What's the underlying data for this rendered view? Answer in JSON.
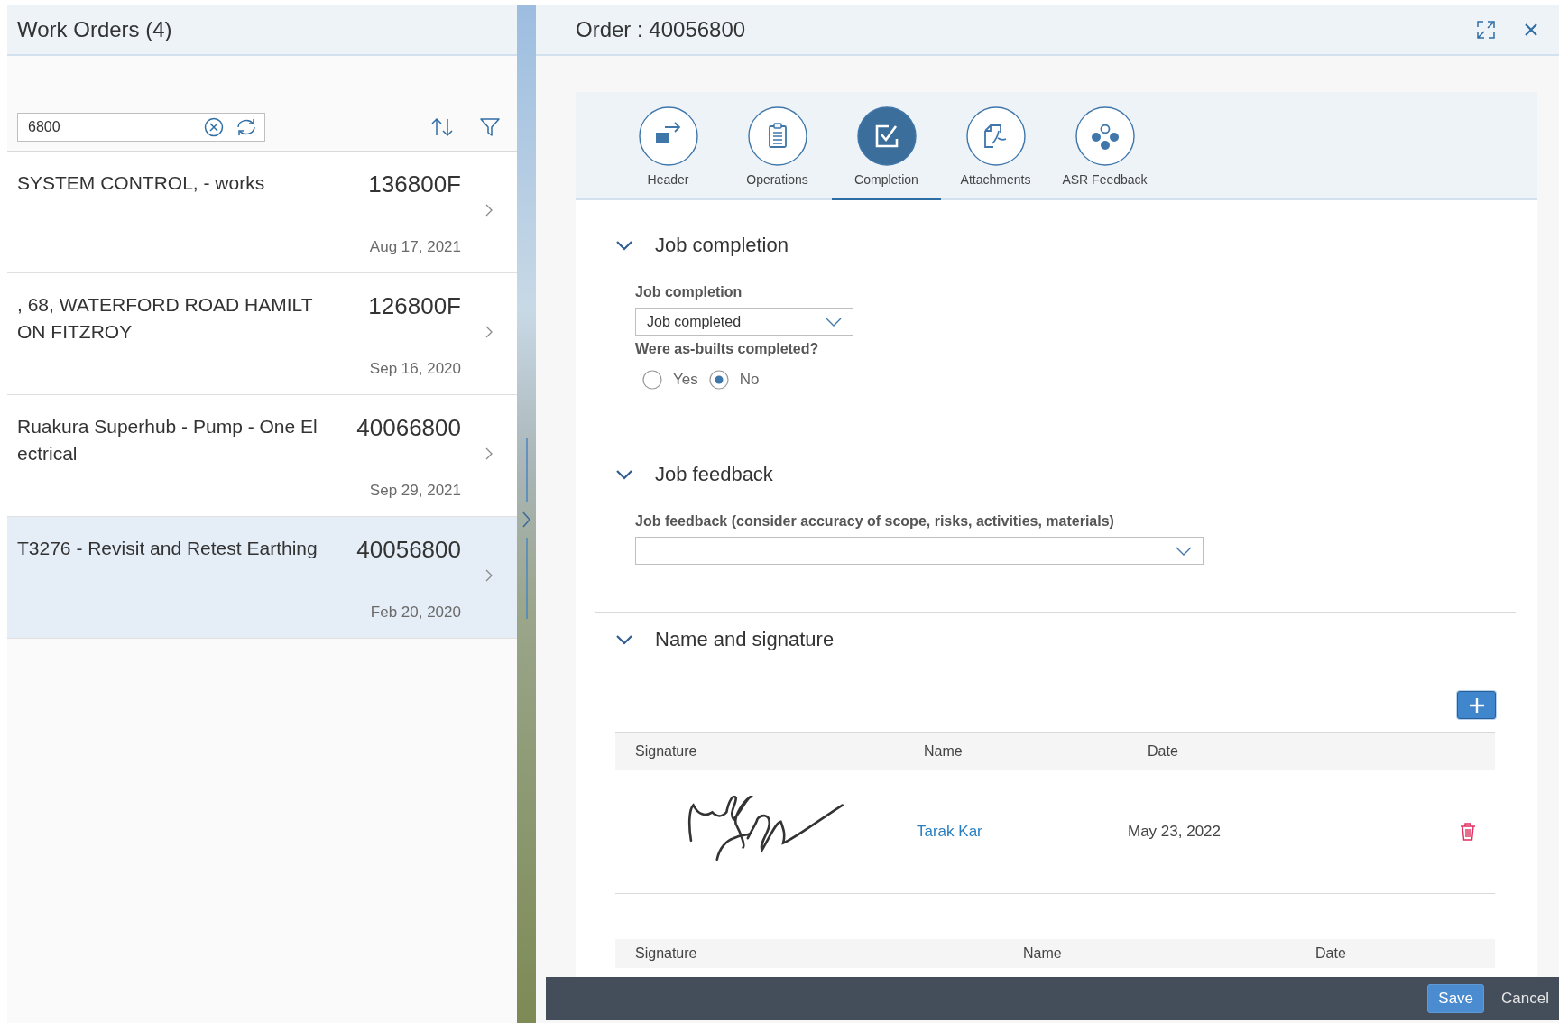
{
  "work_orders": {
    "title": "Work Orders (4)",
    "search": {
      "value": "6800"
    },
    "items": [
      {
        "title": "SYSTEM CONTROL, - works",
        "number": "136800F",
        "date": "Aug 17, 2021",
        "selected": false
      },
      {
        "title": ", 68, WATERFORD ROAD HAMILTON FITZROY",
        "number": "126800F",
        "date": "Sep 16, 2020",
        "selected": false
      },
      {
        "title": "Ruakura Superhub - Pump - One Electrical",
        "number": "40066800",
        "date": "Sep 29, 2021",
        "selected": false
      },
      {
        "title": "T3276 - Revisit and Retest Earthing",
        "number": "40056800",
        "date": "Feb 20, 2020",
        "selected": true
      }
    ]
  },
  "order": {
    "title": "Order : 40056800",
    "tabs": [
      {
        "label": "Header",
        "selected": false
      },
      {
        "label": "Operations",
        "selected": false
      },
      {
        "label": "Completion",
        "selected": true
      },
      {
        "label": "Attachments",
        "selected": false
      },
      {
        "label": "ASR Feedback",
        "selected": false
      }
    ],
    "sections": [
      {
        "kind": "form",
        "title": "Job completion",
        "expanded": true,
        "select": {
          "label": "Job completion",
          "value": "Job completed"
        },
        "question": {
          "label": "Were as-builts completed?",
          "options": [
            {
              "label": "Yes",
              "selected": false
            },
            {
              "label": "No",
              "selected": true
            }
          ]
        }
      },
      {
        "kind": "select",
        "title": "Job feedback",
        "expanded": true,
        "select": {
          "label": "Job feedback (consider accuracy of scope, risks, activities, materials)"
        }
      },
      {
        "kind": "signatures",
        "title": "Name and signature",
        "expanded": true,
        "tables": [
          {
            "columns": [
              "Signature",
              "Name",
              "Date"
            ],
            "rows": [
              {
                "name": "Tarak Kar",
                "date": "May 23, 2022"
              }
            ]
          },
          {
            "columns": [
              "Signature",
              "Name",
              "Date"
            ]
          }
        ]
      }
    ],
    "footer": {
      "buttons": [
        {
          "label": "Save",
          "kind": "primary"
        },
        {
          "label": "Cancel",
          "kind": "plain"
        }
      ]
    }
  }
}
